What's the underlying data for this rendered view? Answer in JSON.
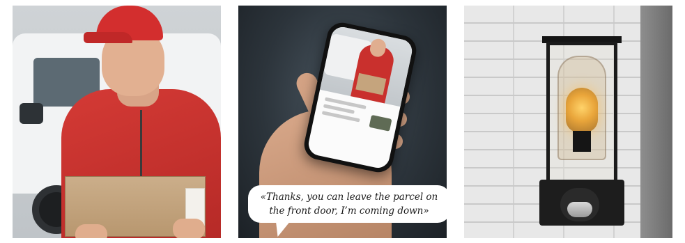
{
  "panels": [
    {
      "id": "delivery",
      "subject": "delivery-person-with-parcel"
    },
    {
      "id": "phone",
      "subject": "hand-holding-smartphone-with-video-call",
      "speech_bubble": {
        "line1": "«Thanks, you can leave the parcel on",
        "line2": "the front door, I’m coming down»"
      }
    },
    {
      "id": "lamp",
      "subject": "outdoor-wall-lamp-with-motion-sensor"
    }
  ],
  "colors": {
    "jacket_red": "#d43a35",
    "cardboard": "#cbae8a",
    "lamp_black": "#1b1b1b",
    "bulb_amber": "#e9a53a"
  }
}
